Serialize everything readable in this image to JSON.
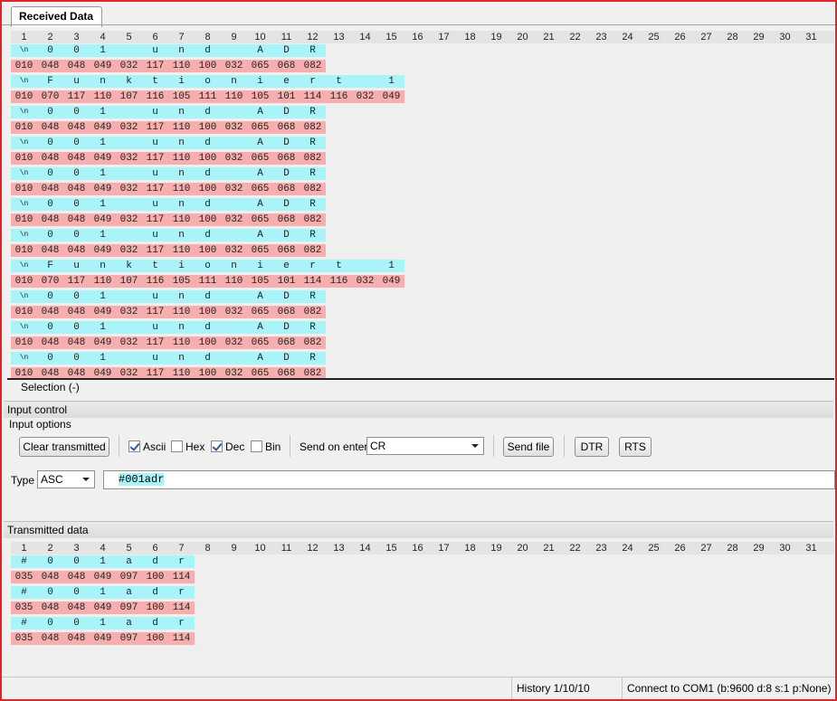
{
  "tab": {
    "label": "Received Data"
  },
  "columns": [
    "1",
    "2",
    "3",
    "4",
    "5",
    "6",
    "7",
    "8",
    "9",
    "10",
    "11",
    "12",
    "13",
    "14",
    "15",
    "16",
    "17",
    "18",
    "19",
    "20",
    "21",
    "22",
    "23",
    "24",
    "25",
    "26",
    "27",
    "28",
    "29",
    "30",
    "31"
  ],
  "received": [
    {
      "asc": [
        "\\n",
        "0",
        "0",
        "1",
        " ",
        "u",
        "n",
        "d",
        " ",
        "A",
        "D",
        "R"
      ],
      "dec": [
        "010",
        "048",
        "048",
        "049",
        "032",
        "117",
        "110",
        "100",
        "032",
        "065",
        "068",
        "082"
      ]
    },
    {
      "asc": [
        "\\n",
        "F",
        "u",
        "n",
        "k",
        "t",
        "i",
        "o",
        "n",
        "i",
        "e",
        "r",
        "t",
        " ",
        "1"
      ],
      "dec": [
        "010",
        "070",
        "117",
        "110",
        "107",
        "116",
        "105",
        "111",
        "110",
        "105",
        "101",
        "114",
        "116",
        "032",
        "049"
      ]
    },
    {
      "asc": [
        "\\n",
        "0",
        "0",
        "1",
        " ",
        "u",
        "n",
        "d",
        " ",
        "A",
        "D",
        "R"
      ],
      "dec": [
        "010",
        "048",
        "048",
        "049",
        "032",
        "117",
        "110",
        "100",
        "032",
        "065",
        "068",
        "082"
      ]
    },
    {
      "asc": [
        "\\n",
        "0",
        "0",
        "1",
        " ",
        "u",
        "n",
        "d",
        " ",
        "A",
        "D",
        "R"
      ],
      "dec": [
        "010",
        "048",
        "048",
        "049",
        "032",
        "117",
        "110",
        "100",
        "032",
        "065",
        "068",
        "082"
      ]
    },
    {
      "asc": [
        "\\n",
        "0",
        "0",
        "1",
        " ",
        "u",
        "n",
        "d",
        " ",
        "A",
        "D",
        "R"
      ],
      "dec": [
        "010",
        "048",
        "048",
        "049",
        "032",
        "117",
        "110",
        "100",
        "032",
        "065",
        "068",
        "082"
      ]
    },
    {
      "asc": [
        "\\n",
        "0",
        "0",
        "1",
        " ",
        "u",
        "n",
        "d",
        " ",
        "A",
        "D",
        "R"
      ],
      "dec": [
        "010",
        "048",
        "048",
        "049",
        "032",
        "117",
        "110",
        "100",
        "032",
        "065",
        "068",
        "082"
      ]
    },
    {
      "asc": [
        "\\n",
        "0",
        "0",
        "1",
        " ",
        "u",
        "n",
        "d",
        " ",
        "A",
        "D",
        "R"
      ],
      "dec": [
        "010",
        "048",
        "048",
        "049",
        "032",
        "117",
        "110",
        "100",
        "032",
        "065",
        "068",
        "082"
      ]
    },
    {
      "asc": [
        "\\n",
        "F",
        "u",
        "n",
        "k",
        "t",
        "i",
        "o",
        "n",
        "i",
        "e",
        "r",
        "t",
        " ",
        "1"
      ],
      "dec": [
        "010",
        "070",
        "117",
        "110",
        "107",
        "116",
        "105",
        "111",
        "110",
        "105",
        "101",
        "114",
        "116",
        "032",
        "049"
      ]
    },
    {
      "asc": [
        "\\n",
        "0",
        "0",
        "1",
        " ",
        "u",
        "n",
        "d",
        " ",
        "A",
        "D",
        "R"
      ],
      "dec": [
        "010",
        "048",
        "048",
        "049",
        "032",
        "117",
        "110",
        "100",
        "032",
        "065",
        "068",
        "082"
      ]
    },
    {
      "asc": [
        "\\n",
        "0",
        "0",
        "1",
        " ",
        "u",
        "n",
        "d",
        " ",
        "A",
        "D",
        "R"
      ],
      "dec": [
        "010",
        "048",
        "048",
        "049",
        "032",
        "117",
        "110",
        "100",
        "032",
        "065",
        "068",
        "082"
      ]
    },
    {
      "asc": [
        "\\n",
        "0",
        "0",
        "1",
        " ",
        "u",
        "n",
        "d",
        " ",
        "A",
        "D",
        "R"
      ],
      "dec": [
        "010",
        "048",
        "048",
        "049",
        "032",
        "117",
        "110",
        "100",
        "032",
        "065",
        "068",
        "082"
      ]
    }
  ],
  "selection": "Selection (-)",
  "input_control": {
    "title": "Input control",
    "options_title": "Input options",
    "clear_label": "Clear transmitted",
    "ascii_label": "Ascii",
    "ascii_checked": true,
    "hex_label": "Hex",
    "hex_checked": false,
    "dec_label": "Dec",
    "dec_checked": true,
    "bin_label": "Bin",
    "bin_checked": false,
    "send_on_enter_label": "Send on enter",
    "send_on_enter_value": "CR",
    "send_file_label": "Send file",
    "dtr_label": "DTR",
    "rts_label": "RTS",
    "type_label": "Type",
    "type_value": "ASC",
    "input_value": "#001adr"
  },
  "transmitted_title": "Transmitted data",
  "transmitted": [
    {
      "asc": [
        "#",
        "0",
        "0",
        "1",
        "a",
        "d",
        "r"
      ],
      "dec": [
        "035",
        "048",
        "048",
        "049",
        "097",
        "100",
        "114"
      ]
    },
    {
      "asc": [
        "#",
        "0",
        "0",
        "1",
        "a",
        "d",
        "r"
      ],
      "dec": [
        "035",
        "048",
        "048",
        "049",
        "097",
        "100",
        "114"
      ]
    },
    {
      "asc": [
        "#",
        "0",
        "0",
        "1",
        "a",
        "d",
        "r"
      ],
      "dec": [
        "035",
        "048",
        "048",
        "049",
        "097",
        "100",
        "114"
      ]
    }
  ],
  "status": {
    "history": "History 1/10/10",
    "connection": "Connect to COM1 (b:9600 d:8 s:1 p:None)"
  },
  "colors": {
    "ascii_cell": "#a8f4f8",
    "dec_cell": "#f7aeae",
    "frame": "#e0242a"
  }
}
